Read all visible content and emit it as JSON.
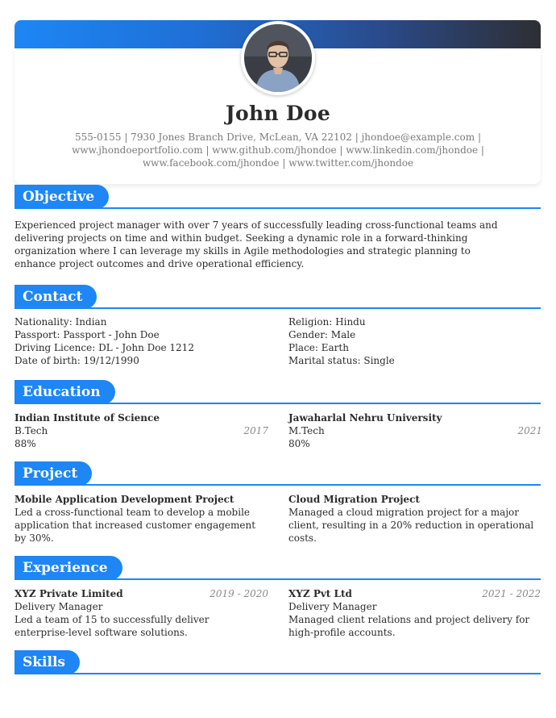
{
  "header": {
    "name": "John Doe",
    "contact_lines": [
      "555-0155 | 7930 Jones Branch Drive, McLean, VA 22102 | jhondoe@example.com |",
      "www.jhondoeportfolio.com | www.github.com/jhondoe | www.linkedin.com/jhondoe |",
      "www.facebook.com/jhondoe | www.twitter.com/jhondoe"
    ]
  },
  "colors": {
    "accent": "#1e86f5",
    "gradient_end": "#2e2e33",
    "text": "#2b2b2b",
    "muted": "#7a7a7a"
  },
  "objective": {
    "title": "Objective",
    "text": "Experienced project manager with over 7 years of successfully leading cross-functional teams and delivering projects on time and within budget. Seeking a dynamic role in a forward-thinking organization where I can leverage my skills in Agile methodologies and strategic planning to enhance project outcomes and drive operational efficiency."
  },
  "contact": {
    "title": "Contact",
    "left": [
      "Nationality: Indian",
      "Passport: Passport - John Doe",
      "Driving Licence: DL - John Doe 1212",
      "Date of birth: 19/12/1990"
    ],
    "right": [
      "Religion: Hindu",
      "Gender: Male",
      "Place: Earth",
      "Marital status: Single"
    ]
  },
  "education": {
    "title": "Education",
    "items": [
      {
        "school": "Indian Institute of Science",
        "year": "2017",
        "degree": "B.Tech",
        "score": "88%"
      },
      {
        "school": "Jawaharlal Nehru University",
        "year": "2021",
        "degree": "M.Tech",
        "score": "80%"
      }
    ]
  },
  "project": {
    "title": "Project",
    "items": [
      {
        "name": "Mobile Application Development Project",
        "desc": "Led a cross-functional team to develop a mobile application that increased customer engagement by 30%."
      },
      {
        "name": "Cloud Migration Project",
        "desc": "Managed a cloud migration project for a major client, resulting in a 20% reduction in operational costs."
      }
    ]
  },
  "experience": {
    "title": "Experience",
    "items": [
      {
        "company": "XYZ Private Limited",
        "period": "2019 - 2020",
        "role": "Delivery Manager",
        "desc": "Led a team of 15 to successfully deliver enterprise-level software solutions."
      },
      {
        "company": "XYZ Pvt Ltd",
        "period": "2021 - 2022",
        "role": "Delivery Manager",
        "desc": "Managed client relations and project delivery for high-profile accounts."
      }
    ]
  },
  "skills": {
    "title": "Skills"
  }
}
